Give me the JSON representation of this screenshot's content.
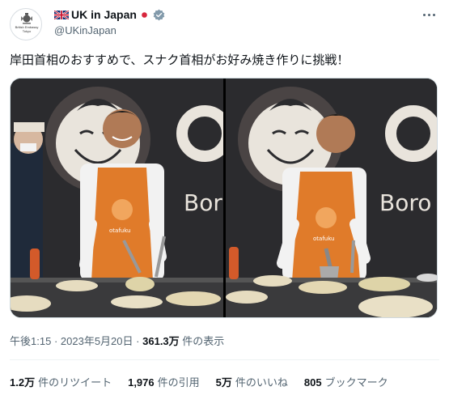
{
  "account": {
    "display_name": "UK in Japan",
    "handle": "@UKinJapan",
    "avatar_caption": "British Embassy Tokyo"
  },
  "tweet": {
    "text": "岸田首相のおすすめで、スナク首相がお好み焼き作りに挑戦！"
  },
  "media": {
    "photos": [
      {
        "name": "photo-1",
        "sign_text": "O",
        "sign_sub": "Bor",
        "apron_text": "otafuku"
      },
      {
        "name": "photo-2",
        "sign_text": "O",
        "sign_sub": "Boro",
        "apron_text": "otafuku"
      }
    ]
  },
  "meta": {
    "time": "午後1:15",
    "sep": "·",
    "date": "2023年5月20日",
    "views_count": "361.3万",
    "views_label": "件の表示"
  },
  "stats": {
    "retweets_count": "1.2万",
    "retweets_label": "件のリツイート",
    "quotes_count": "1,976",
    "quotes_label": "件の引用",
    "likes_count": "5万",
    "likes_label": "件のいいね",
    "bookmarks_count": "805",
    "bookmarks_label": "ブックマーク"
  },
  "colors": {
    "verified": "#829aab",
    "muted": "#536471",
    "apron": "#e07b2a"
  },
  "icons": [
    "union-jack-icon",
    "japan-flag-icon",
    "verified-badge-icon",
    "more-options-icon",
    "royal-crest-icon"
  ]
}
